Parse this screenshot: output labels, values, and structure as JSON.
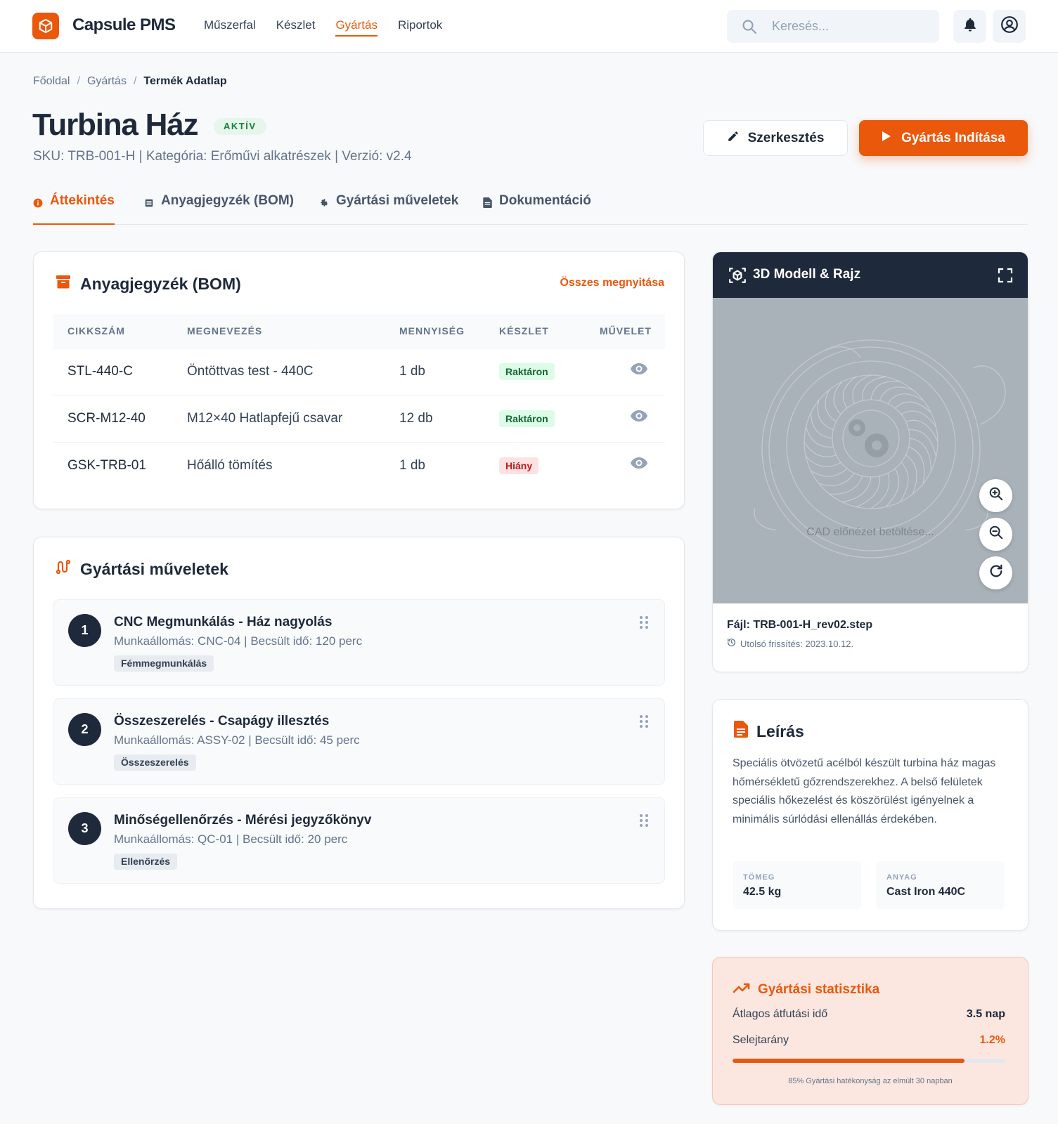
{
  "app": {
    "brand": "Capsule PMS",
    "nav": [
      "Műszerfal",
      "Készlet",
      "Gyártás",
      "Riportok"
    ],
    "active_nav": "Gyártás",
    "search_placeholder": "Keresés..."
  },
  "breadcrumb": [
    "Főoldal",
    "Gyártás",
    "Termék Adatlap"
  ],
  "product": {
    "title": "Turbina Ház",
    "status": "AKTÍV",
    "meta": "SKU: TRB-001-H | Kategória: Erőművi alkatrészek | Verzió: v2.4"
  },
  "actions": {
    "edit": "Szerkesztés",
    "start": "Gyártás Indítása"
  },
  "tabs": [
    "Áttekintés",
    "Anyagjegyzék (BOM)",
    "Gyártási műveletek",
    "Dokumentáció"
  ],
  "bom": {
    "title": "Anyagjegyzék (BOM)",
    "link": "Összes megnyitása",
    "headers": [
      "CIKKSZÁM",
      "MEGNEVEZÉS",
      "MENNYISÉG",
      "KÉSZLET",
      "MŰVELET"
    ],
    "rows": [
      {
        "sku": "STL-440-C",
        "name": "Öntöttvas test - 440C",
        "qty": "1 db",
        "stock": "Raktáron",
        "stock_ok": true
      },
      {
        "sku": "SCR-M12-40",
        "name": "M12×40 Hatlapfejű csavar",
        "qty": "12 db",
        "stock": "Raktáron",
        "stock_ok": true
      },
      {
        "sku": "GSK-TRB-01",
        "name": "Hőálló tömítés",
        "qty": "1 db",
        "stock": "Hiány",
        "stock_ok": false
      }
    ]
  },
  "operations": {
    "title": "Gyártási műveletek",
    "items": [
      {
        "num": "1",
        "title": "CNC Megmunkálás - Ház nagyolás",
        "sub": "Munkaállomás: CNC-04 | Becsült idő: 120 perc",
        "tag": "Fémmegmunkálás"
      },
      {
        "num": "2",
        "title": "Összeszerelés - Csapágy illesztés",
        "sub": "Munkaállomás: ASSY-02 | Becsült idő: 45 perc",
        "tag": "Összeszerelés"
      },
      {
        "num": "3",
        "title": "Minőségellenőrzés - Mérési jegyzőkönyv",
        "sub": "Munkaállomás: QC-01 | Becsült idő: 20 perc",
        "tag": "Ellenőrzés"
      }
    ]
  },
  "model": {
    "title": "3D Modell & Rajz",
    "loading": "CAD előnézet betöltése...",
    "file": "Fájl: TRB-001-H_rev02.step",
    "updated": "Utolsó frissítés: 2023.10.12."
  },
  "description": {
    "title": "Leírás",
    "text": "Speciális ötvözetű acélból készült turbina ház magas hőmérsékletű gőzrendszerekhez. A belső felületek speciális hőkezelést és köszörülést igényelnek a minimális súrlódási ellenállás érdekében.",
    "specs": [
      {
        "label": "TÖMEG",
        "value": "42.5 kg"
      },
      {
        "label": "ANYAG",
        "value": "Cast Iron 440C"
      }
    ]
  },
  "stats": {
    "title": "Gyártási statisztika",
    "rows": [
      {
        "label": "Átlagos átfutási idő",
        "value": "3.5 nap"
      },
      {
        "label": "Selejtarány",
        "value": "1.2%"
      }
    ],
    "efficiency": 0.85,
    "note": "85% Gyártási hatékonyság az elmúlt 30 napban"
  },
  "colors": {
    "accent": "#ea580c",
    "dark": "#1e293b",
    "success_bg": "#dcfce7",
    "danger_bg": "#fee2e2"
  }
}
